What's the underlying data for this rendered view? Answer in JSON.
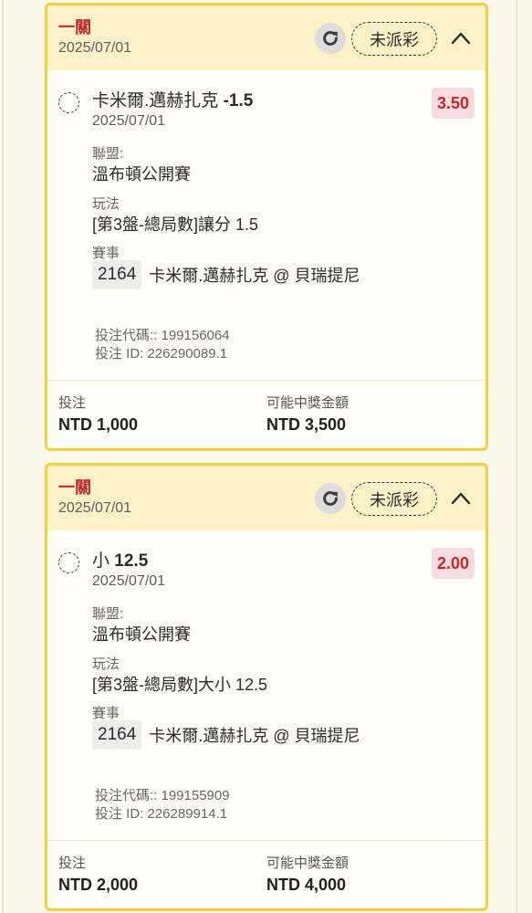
{
  "bets": [
    {
      "stage": "一關",
      "header_date": "2025/07/01",
      "status": "未派彩",
      "selection_prefix": "卡米爾.邁赫扎克 ",
      "selection_bold": "-1.5",
      "odds": "3.50",
      "selection_date": "2025/07/01",
      "league_label": "聯盟:",
      "league": "溫布頓公開賽",
      "market_label": "玩法",
      "market": "[第3盤-總局數]讓分 1.5",
      "event_label": "賽事",
      "event_id": "2164",
      "event_name": "卡米爾.邁赫扎克 @ 貝瑞提尼",
      "bet_code": "投注代碼:: 199156064",
      "bet_id": "投注 ID: 226290089.1",
      "stake_label": "投注",
      "stake": "NTD 1,000",
      "payout_label": "可能中獎金額",
      "payout": "NTD 3,500"
    },
    {
      "stage": "一關",
      "header_date": "2025/07/01",
      "status": "未派彩",
      "selection_prefix": "小 ",
      "selection_bold": "12.5",
      "odds": "2.00",
      "selection_date": "2025/07/01",
      "league_label": "聯盟:",
      "league": "溫布頓公開賽",
      "market_label": "玩法",
      "market": "[第3盤-總局數]大小 12.5",
      "event_label": "賽事",
      "event_id": "2164",
      "event_name": "卡米爾.邁赫扎克 @ 貝瑞提尼",
      "bet_code": "投注代碼:: 199155909",
      "bet_id": "投注 ID: 226289914.1",
      "stake_label": "投注",
      "stake": "NTD 2,000",
      "payout_label": "可能中獎金額",
      "payout": "NTD 4,000"
    }
  ],
  "icons": {
    "refresh": "refresh-icon",
    "collapse": "chevron-up-icon",
    "radio": "radio-unchecked-icon"
  },
  "colors": {
    "accent_border": "#f2d23c",
    "header_bg": "#fdf1c7",
    "stage_red": "#c0282d",
    "odds_bg": "#f6dcdc"
  }
}
